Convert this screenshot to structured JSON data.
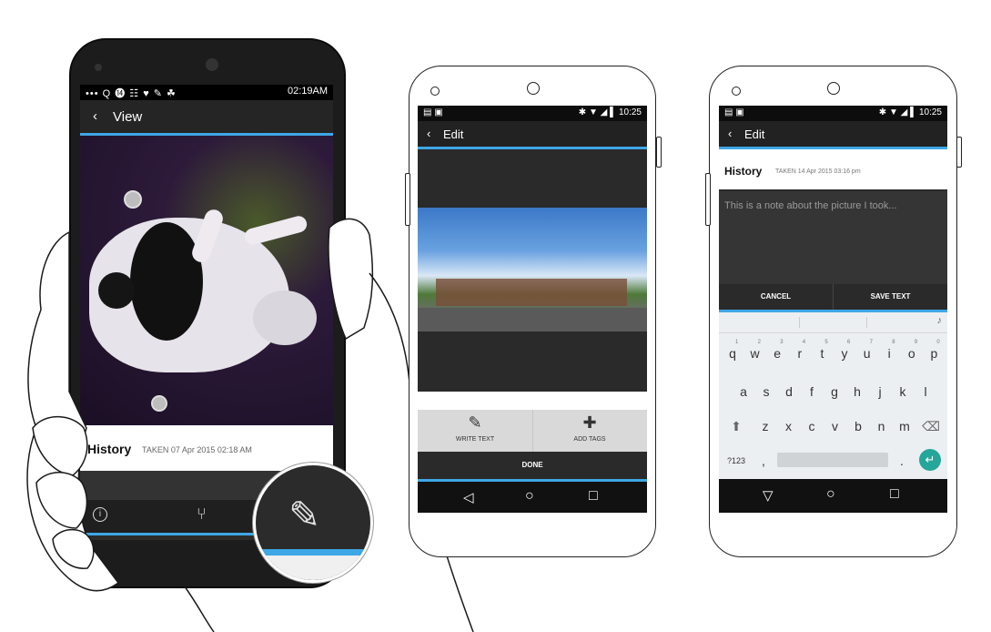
{
  "phone_view": {
    "status_left": "••• Q ⓮ ☷ ♥ ✎ ☘",
    "status_time": "02:19AM",
    "back_icon": "‹",
    "title": "View",
    "history_title": "History",
    "history_taken": "TAKEN 07 Apr 2015 02:18 AM",
    "info_icon": "i",
    "share_icon": "⑂",
    "edit_icon": "✎"
  },
  "phone_edit": {
    "status_left": "▤ ▣",
    "status_right": "✱ ▼ ◢ ▌ 10:25",
    "back_icon": "‹",
    "title": "Edit",
    "write_text_icon": "✎",
    "write_text_label": "WRITE TEXT",
    "add_tags_icon": "✚",
    "add_tags_label": "ADD TAGS",
    "done_label": "DONE",
    "nav_back": "◁",
    "nav_home": "○",
    "nav_recent": "□"
  },
  "phone_note": {
    "status_left": "▤ ▣",
    "status_right": "✱ ▼ ◢ ▌ 10:25",
    "back_icon": "‹",
    "title": "Edit",
    "history_title": "History",
    "history_taken": "TAKEN 14 Apr 2015 03:16 pm",
    "note_placeholder": "This is a note about the picture I took...",
    "cancel_label": "CANCEL",
    "save_label": "SAVE TEXT",
    "mic_icon": "♪",
    "keys_row1": [
      "q",
      "w",
      "e",
      "r",
      "t",
      "y",
      "u",
      "i",
      "o",
      "p"
    ],
    "keys_row1_nums": [
      "1",
      "2",
      "3",
      "4",
      "5",
      "6",
      "7",
      "8",
      "9",
      "0"
    ],
    "keys_row2": [
      "a",
      "s",
      "d",
      "f",
      "g",
      "h",
      "j",
      "k",
      "l"
    ],
    "keys_row3": [
      "z",
      "x",
      "c",
      "v",
      "b",
      "n",
      "m"
    ],
    "shift_icon": "⬆",
    "delete_icon": "⌫",
    "symbols_key": "?123",
    "comma_key": ",",
    "period_key": ".",
    "enter_icon": "↵",
    "nav_back": "▽",
    "nav_home": "○",
    "nav_recent": "□"
  },
  "colors": {
    "accent": "#3ea7e6",
    "enter_key": "#26a69a"
  }
}
